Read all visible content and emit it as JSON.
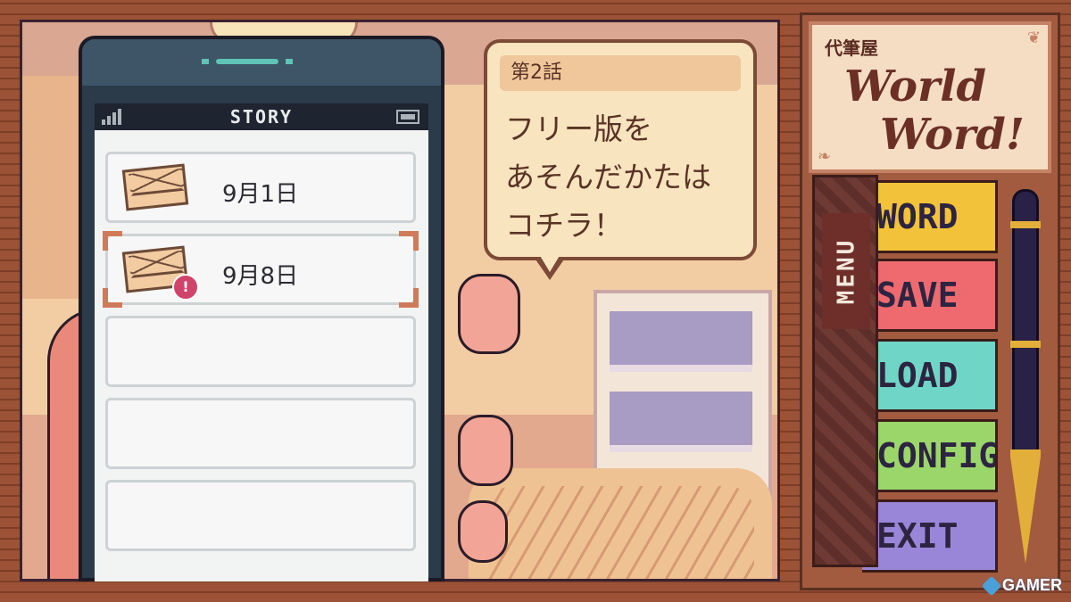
{
  "phone": {
    "status_title": "STORY",
    "items": [
      {
        "date": "9月1日",
        "new": false,
        "selected": false
      },
      {
        "date": "9月8日",
        "new": true,
        "selected": true
      },
      {
        "date": "",
        "new": false,
        "selected": false
      },
      {
        "date": "",
        "new": false,
        "selected": false
      },
      {
        "date": "",
        "new": false,
        "selected": false
      }
    ],
    "new_badge": "!"
  },
  "bubble": {
    "chapter": "第2話",
    "text": "フリー版を\nあそんだかたは\nコチラ！"
  },
  "title_card": {
    "jp": "代筆屋",
    "en_line1": "World",
    "en_line2": "Word!"
  },
  "menu": {
    "label": "MENU",
    "buttons": [
      {
        "label": "WORD",
        "color": "#f2c23a"
      },
      {
        "label": "SAVE",
        "color": "#ee6a6f"
      },
      {
        "label": "LOAD",
        "color": "#6fd6c7"
      },
      {
        "label": "CONFIG",
        "color": "#9bd66a"
      },
      {
        "label": "EXIT",
        "color": "#9a86d8"
      }
    ]
  },
  "watermark": "GAMER"
}
